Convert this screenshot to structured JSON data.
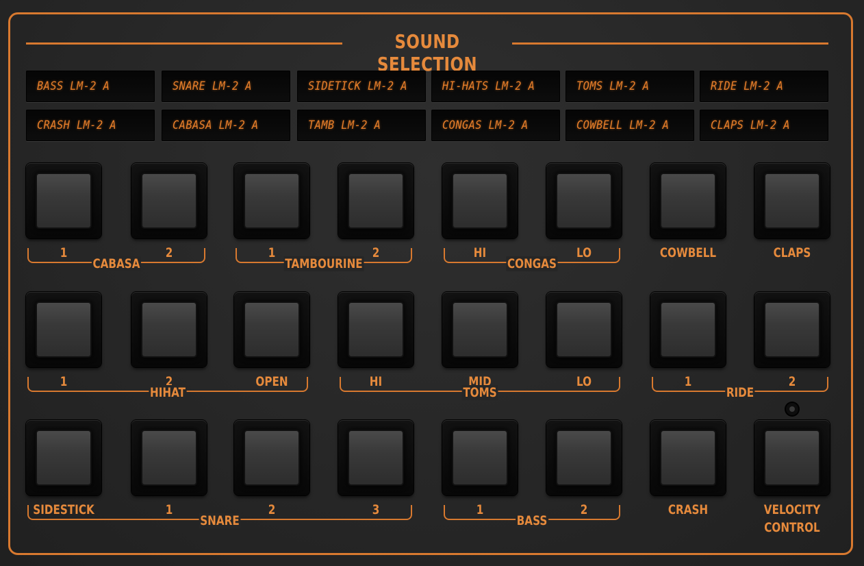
{
  "panel": {
    "title": "SOUND SELECTION",
    "accent_color": "#d8792f",
    "lcd_text_color": "#e87f2a"
  },
  "displays": [
    "BASS LM-2 A",
    "SNARE LM-2 A",
    "SIDETICK LM-2 A",
    "HI-HATS LM-2 A",
    "TOMS LM-2 A",
    "RIDE LM-2 A",
    "CRASH LM-2 A",
    "CABASA LM-2 A",
    "TAMB LM-2 A",
    "CONGAS LM-2 A",
    "COWBELL LM-2 A",
    "CLAPS LM-2 A"
  ],
  "row1": {
    "pads": [
      "1",
      "2",
      "1",
      "2",
      "HI",
      "LO",
      "COWBELL",
      "CLAPS"
    ],
    "groups": [
      "CABASA",
      "TAMBOURINE",
      "CONGAS"
    ]
  },
  "row2": {
    "pads": [
      "1",
      "2",
      "OPEN",
      "HI",
      "MID",
      "LO",
      "1",
      "2"
    ],
    "groups": [
      "HIHAT",
      "TOMS",
      "RIDE"
    ]
  },
  "row3": {
    "pads": [
      "SIDESTICK",
      "1",
      "2",
      "3",
      "1",
      "2",
      "CRASH",
      "VELOCITY\nCONTROL"
    ],
    "groups": [
      "SNARE",
      "BASS"
    ]
  }
}
